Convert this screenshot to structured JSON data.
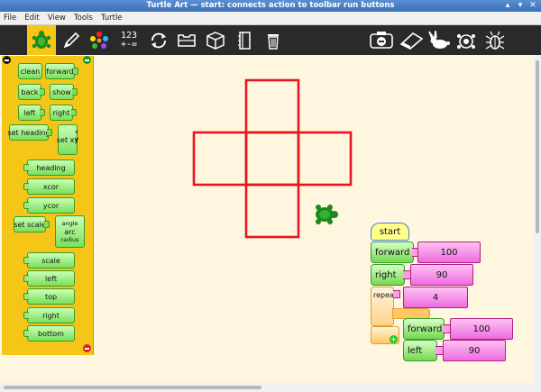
{
  "window": {
    "title": "Turtle Art — start: connects action to toolbar run buttons",
    "buttons": [
      "▴",
      "▾",
      "✕"
    ]
  },
  "menu": [
    "File",
    "Edit",
    "View",
    "Tools",
    "Turtle"
  ],
  "toolbar": {
    "left_tools": [
      "turtle-palette-icon",
      "pen-icon",
      "colors-icon",
      "number-icon",
      "flow-icon",
      "blocks-icon",
      "extras-icon",
      "presentation-icon",
      "trash-icon"
    ],
    "calc_line1": "123",
    "calc_line2": "+-=",
    "right_tools": [
      "clean-icon",
      "eraser-icon",
      "rabbit-icon",
      "turtle-step-icon",
      "bug-icon"
    ],
    "active_color": "#f5c518"
  },
  "palette": {
    "blocks": [
      "clean",
      "forward",
      "back",
      "show",
      "left",
      "right",
      "set heading",
      "set xy",
      "heading",
      "xcor",
      "ycor",
      "set scale",
      "scale",
      "left",
      "top",
      "right",
      "bottom"
    ],
    "setxy_args": [
      "x",
      "y"
    ],
    "arc_args": [
      "angle",
      "arc",
      "radius"
    ]
  },
  "program": {
    "start_label": "start",
    "forward1_label": "forward",
    "forward1_value": "100",
    "right_label": "right",
    "right_value": "90",
    "repeat_label": "repeat",
    "repeat_value": "4",
    "forward2_label": "forward",
    "forward2_value": "100",
    "left_label": "left",
    "left_value": "90"
  },
  "colors": {
    "palette_bg": "#f5c518",
    "canvas_bg": "#fff6e0",
    "drawing": "#e8141e",
    "turtle": "#1a8a1a"
  }
}
